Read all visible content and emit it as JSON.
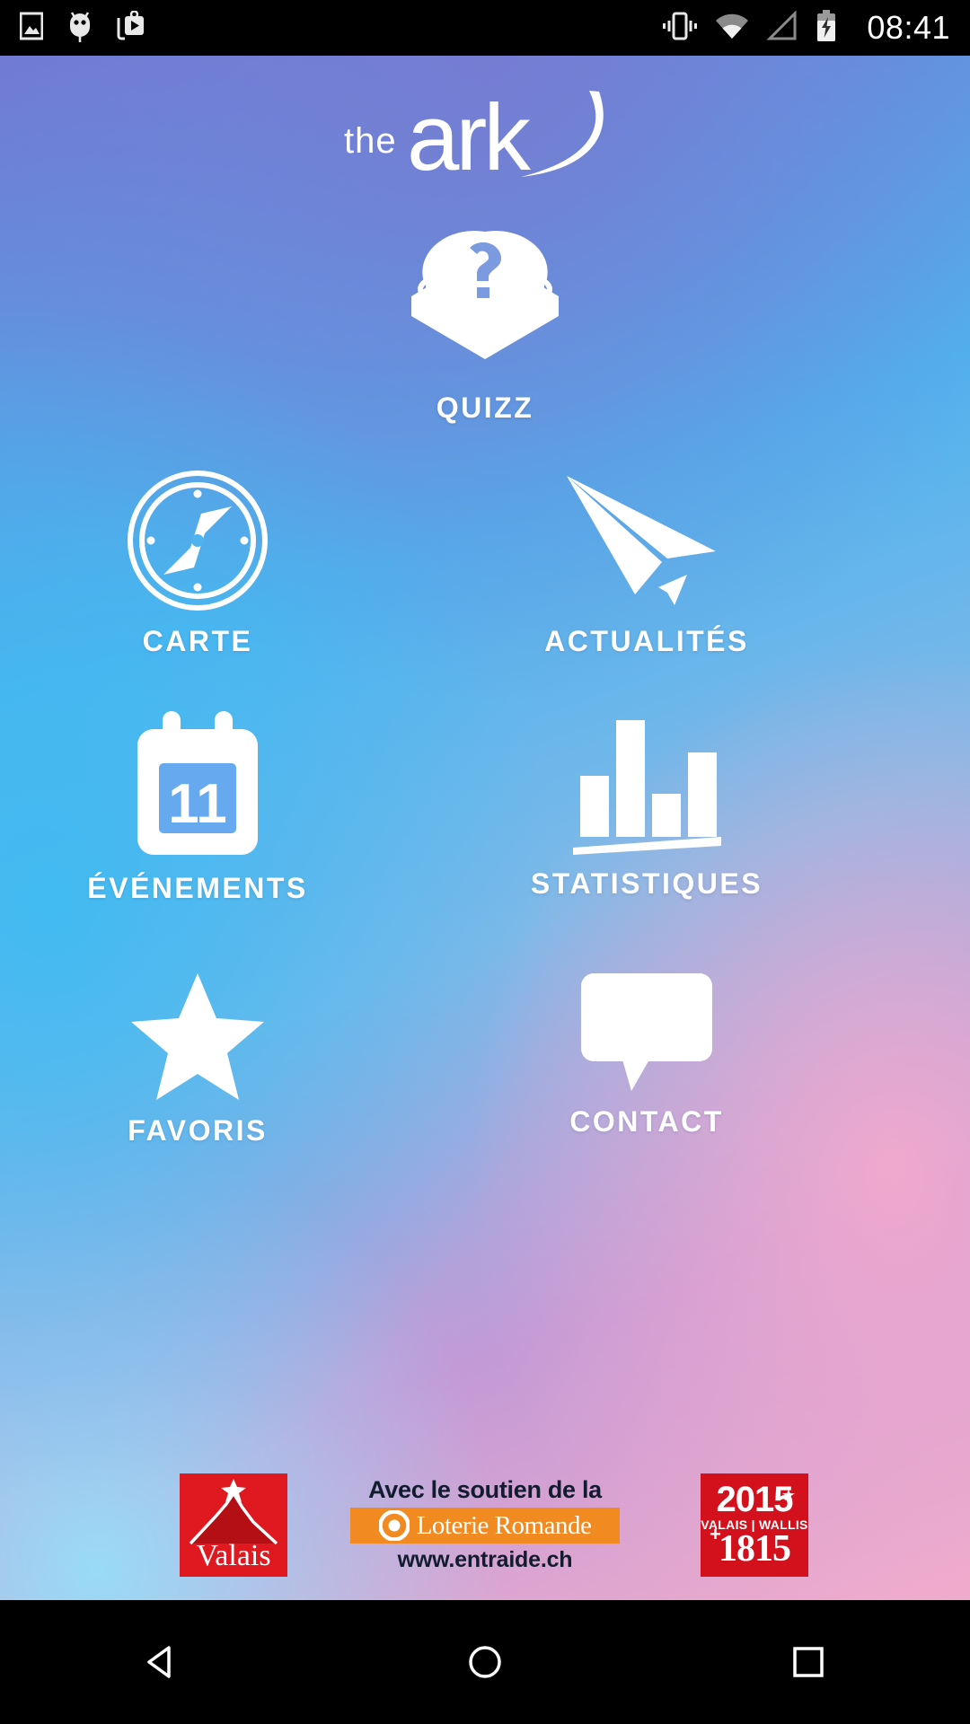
{
  "status_bar": {
    "icons_left": [
      "image-icon",
      "android-debug-icon",
      "media-play-icon"
    ],
    "icons_right": [
      "vibrate-icon",
      "wifi-icon",
      "cell-signal-icon",
      "battery-charging-icon"
    ],
    "time": "08:41"
  },
  "app": {
    "logo_prefix": "the",
    "logo_name": "ark"
  },
  "menu": [
    {
      "id": "quizz",
      "label": "QUIZZ",
      "icon": "quiz-buzzer-icon"
    },
    {
      "id": "carte",
      "label": "CARTE",
      "icon": "compass-icon"
    },
    {
      "id": "actu",
      "label": "ACTUALITÉS",
      "icon": "paper-plane-icon"
    },
    {
      "id": "events",
      "label": "ÉVÉNEMENTS",
      "icon": "calendar-icon",
      "badge": "11"
    },
    {
      "id": "stats",
      "label": "STATISTIQUES",
      "icon": "bar-chart-icon"
    },
    {
      "id": "favoris",
      "label": "FAVORIS",
      "icon": "star-icon"
    },
    {
      "id": "contact",
      "label": "CONTACT",
      "icon": "speech-bubble-icon"
    }
  ],
  "sponsors": {
    "valais": {
      "name": "Valais",
      "icon": "matterhorn-star-icon"
    },
    "loterie": {
      "top_text": "Avec le soutien de la",
      "brand": "Loterie Romande",
      "url": "www.entraide.ch"
    },
    "anniversary": {
      "year": "2015",
      "subtitle": "VALAIS | WALLIS",
      "origin": "1815",
      "plus": "+",
      "star": "★"
    }
  },
  "nav_bar": {
    "back": "back-triangle-icon",
    "home": "home-circle-icon",
    "recents": "recents-square-icon"
  },
  "colors": {
    "accent_orange": "#f18a21",
    "valais_red": "#e0181f",
    "anniversary_red": "#d2111d",
    "icon_white": "#ffffff"
  }
}
